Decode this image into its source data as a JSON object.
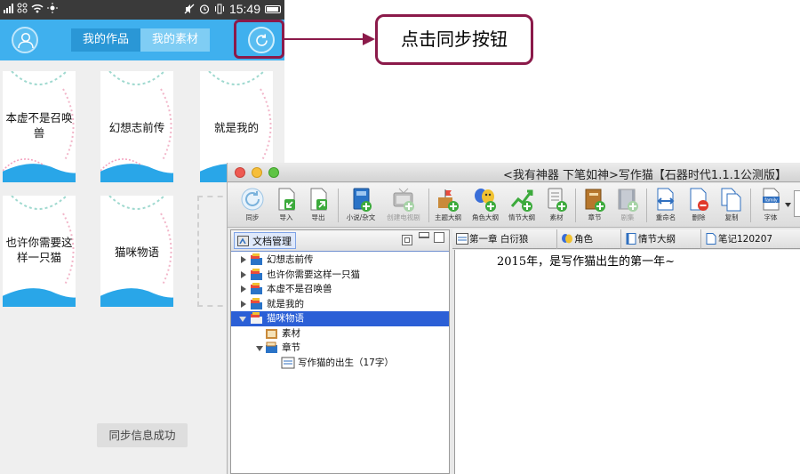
{
  "phone": {
    "status": {
      "time": "15:49"
    },
    "tabs": [
      "我的作品",
      "我的素材"
    ],
    "works": [
      {
        "title": "本虚不是召唤兽"
      },
      {
        "title": "幻想志前传"
      },
      {
        "title": "就是我的"
      },
      {
        "title": "也许你需要这样一只猫"
      },
      {
        "title": "猫咪物语"
      }
    ],
    "toast": "同步信息成功"
  },
  "callout": {
    "text": "点击同步按钮",
    "color": "#8b1a4a"
  },
  "window": {
    "title": "<我有神器 下笔如神>写作猫【石器时代1.1.1公测版】",
    "toolbar": [
      {
        "label": "同步",
        "icon": "sync-icon"
      },
      {
        "label": "导入",
        "icon": "import-icon"
      },
      {
        "label": "导出",
        "icon": "export-icon"
      },
      {
        "label": "小说/杂文",
        "icon": "book-icon"
      },
      {
        "label": "创建电视剧",
        "icon": "tv-icon"
      },
      {
        "label": "主题大纲",
        "icon": "theme-outline-icon"
      },
      {
        "label": "角色大纲",
        "icon": "character-outline-icon"
      },
      {
        "label": "情节大纲",
        "icon": "plot-outline-icon"
      },
      {
        "label": "素材",
        "icon": "material-icon"
      },
      {
        "label": "章节",
        "icon": "chapter-icon"
      },
      {
        "label": "剧集",
        "icon": "episode-icon"
      },
      {
        "label": "重命名",
        "icon": "rename-icon"
      },
      {
        "label": "删除",
        "icon": "delete-icon"
      },
      {
        "label": "复制",
        "icon": "copy-icon"
      },
      {
        "label": "字体",
        "icon": "font-icon"
      }
    ],
    "font_icon_text": "family",
    "panel": {
      "title": "文档管理",
      "tree": [
        {
          "label": "幻想志前传"
        },
        {
          "label": "也许你需要这样一只猫"
        },
        {
          "label": "本虚不是召唤兽"
        },
        {
          "label": "就是我的"
        },
        {
          "label": "猫咪物语"
        },
        {
          "label": "素材"
        },
        {
          "label": "章节"
        },
        {
          "label": "写作猫的出生（17字）"
        }
      ]
    },
    "editor_tabs": [
      "第一章 白衍狼",
      "角色",
      "情节大纲",
      "笔记120207"
    ],
    "editor_text": "2015年，是写作猫出生的第一年~"
  }
}
